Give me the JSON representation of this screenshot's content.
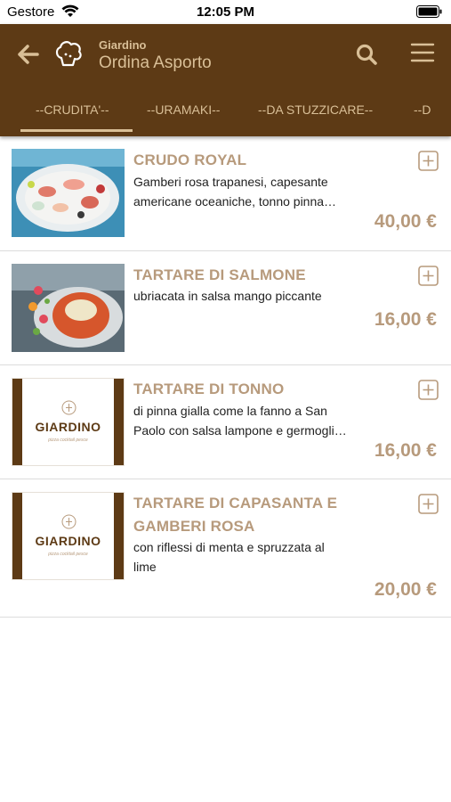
{
  "status": {
    "carrier": "Gestore",
    "time": "12:05 PM"
  },
  "header": {
    "subtitle": "Giardino",
    "title": "Ordina Asporto",
    "brand_color": "#5d3a15",
    "accent_color": "#d9bf97"
  },
  "tabs": [
    {
      "label": "--CRUDITA'--",
      "selected": true
    },
    {
      "label": "--URAMAKI--",
      "selected": false
    },
    {
      "label": "--DA STUZZICARE--",
      "selected": false
    },
    {
      "label": "--D",
      "selected": false
    }
  ],
  "items": [
    {
      "name_line1": "CRUDO ROYAL",
      "name_line2": "",
      "desc_line1": "Gamberi rosa trapanesi, capesante",
      "desc_line2": "americane oceaniche, tonno pinna…",
      "price": "40,00 €",
      "image": "seafood-platter-photo"
    },
    {
      "name_line1": "TARTARE DI SALMONE",
      "name_line2": "",
      "desc_line1": "ubriacata in salsa mango piccante",
      "desc_line2": "",
      "price": "16,00 €",
      "image": "salmon-tartare-photo"
    },
    {
      "name_line1": "TARTARE DI TONNO",
      "name_line2": "",
      "desc_line1": "di pinna gialla come la fanno a San",
      "desc_line2": "Paolo con salsa lampone e germogli…",
      "price": "16,00 €",
      "image": "giardino-logo-placeholder"
    },
    {
      "name_line1": "TARTARE DI CAPASANTA E",
      "name_line2": "GAMBERI ROSA",
      "desc_line1": "con riflessi di menta e spruzzata al",
      "desc_line2": "lime",
      "price": "20,00 €",
      "image": "giardino-logo-placeholder"
    }
  ],
  "placeholder_logo": {
    "word": "GIARDINO",
    "tagline": "pizza cocktail pesce"
  }
}
